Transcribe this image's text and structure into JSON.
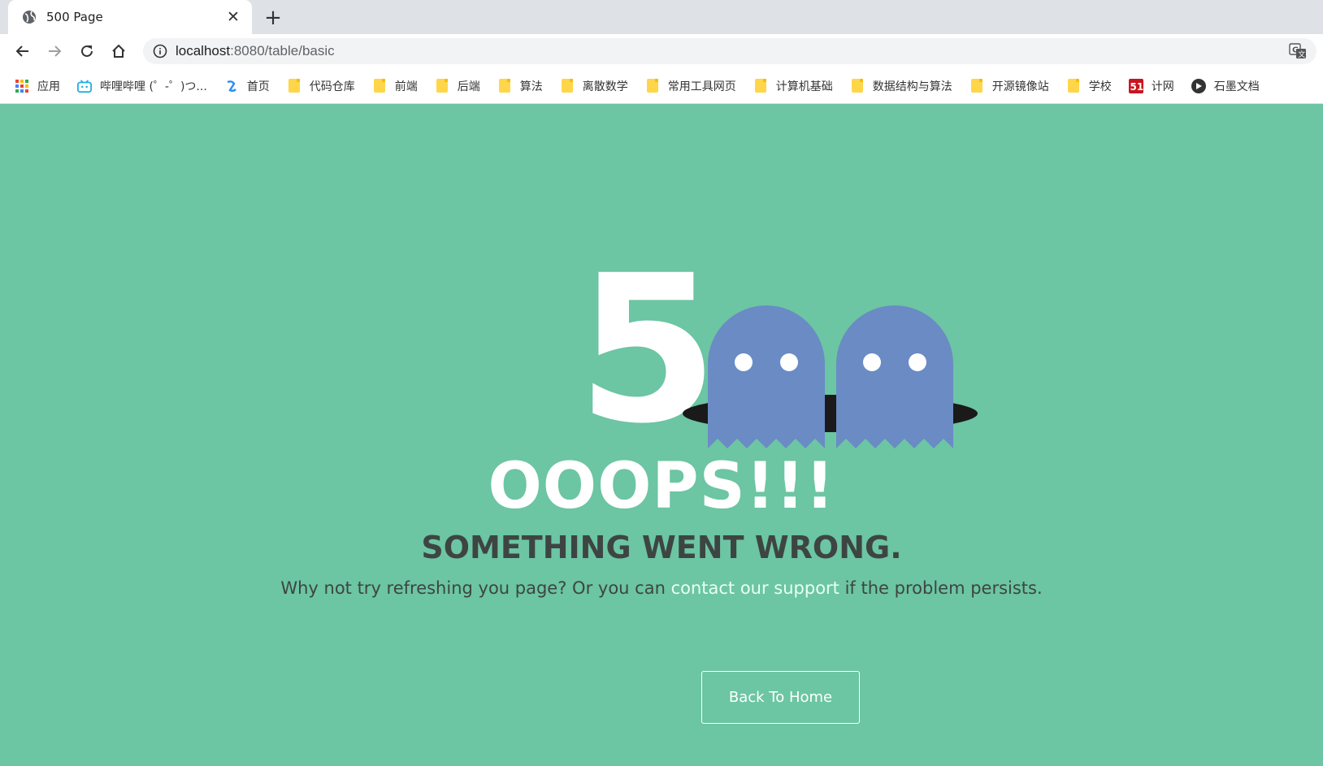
{
  "tab": {
    "title": "500 Page",
    "close_label": "✕",
    "new_tab_label": "+"
  },
  "toolbar": {
    "url_host": "localhost",
    "url_rest": ":8080/table/basic"
  },
  "bookmarks": [
    {
      "label": "应用",
      "icon": "apps-grid-icon"
    },
    {
      "label": "哔哩哔哩 (゜-゜)つ...",
      "icon": "bilibili-icon"
    },
    {
      "label": "首页",
      "icon": "home-site-icon"
    },
    {
      "label": "代码仓库",
      "icon": "folder-icon"
    },
    {
      "label": "前端",
      "icon": "folder-icon"
    },
    {
      "label": "后端",
      "icon": "folder-icon"
    },
    {
      "label": "算法",
      "icon": "folder-icon"
    },
    {
      "label": "离散数学",
      "icon": "folder-icon"
    },
    {
      "label": "常用工具网页",
      "icon": "folder-icon"
    },
    {
      "label": "计算机基础",
      "icon": "folder-icon"
    },
    {
      "label": "数据结构与算法",
      "icon": "folder-icon"
    },
    {
      "label": "开源镜像站",
      "icon": "folder-icon"
    },
    {
      "label": "学校",
      "icon": "folder-icon"
    },
    {
      "label": "计网",
      "icon": "51cto-icon"
    },
    {
      "label": "石墨文档",
      "icon": "shimo-icon"
    }
  ],
  "error": {
    "digit": "5",
    "headline": "OOOPS!!!",
    "subheadline": "SOMETHING WENT WRONG.",
    "desc_before": "Why not try refreshing you page? Or you can ",
    "desc_link": "contact our support",
    "desc_after": " if the problem persists.",
    "button_label": "Back To Home"
  },
  "colors": {
    "background": "#6cc5a3",
    "ghost": "#6a8bc4",
    "hole": "#1a1a1a",
    "link": "#e8fff5",
    "dark_text": "#3d4543"
  }
}
